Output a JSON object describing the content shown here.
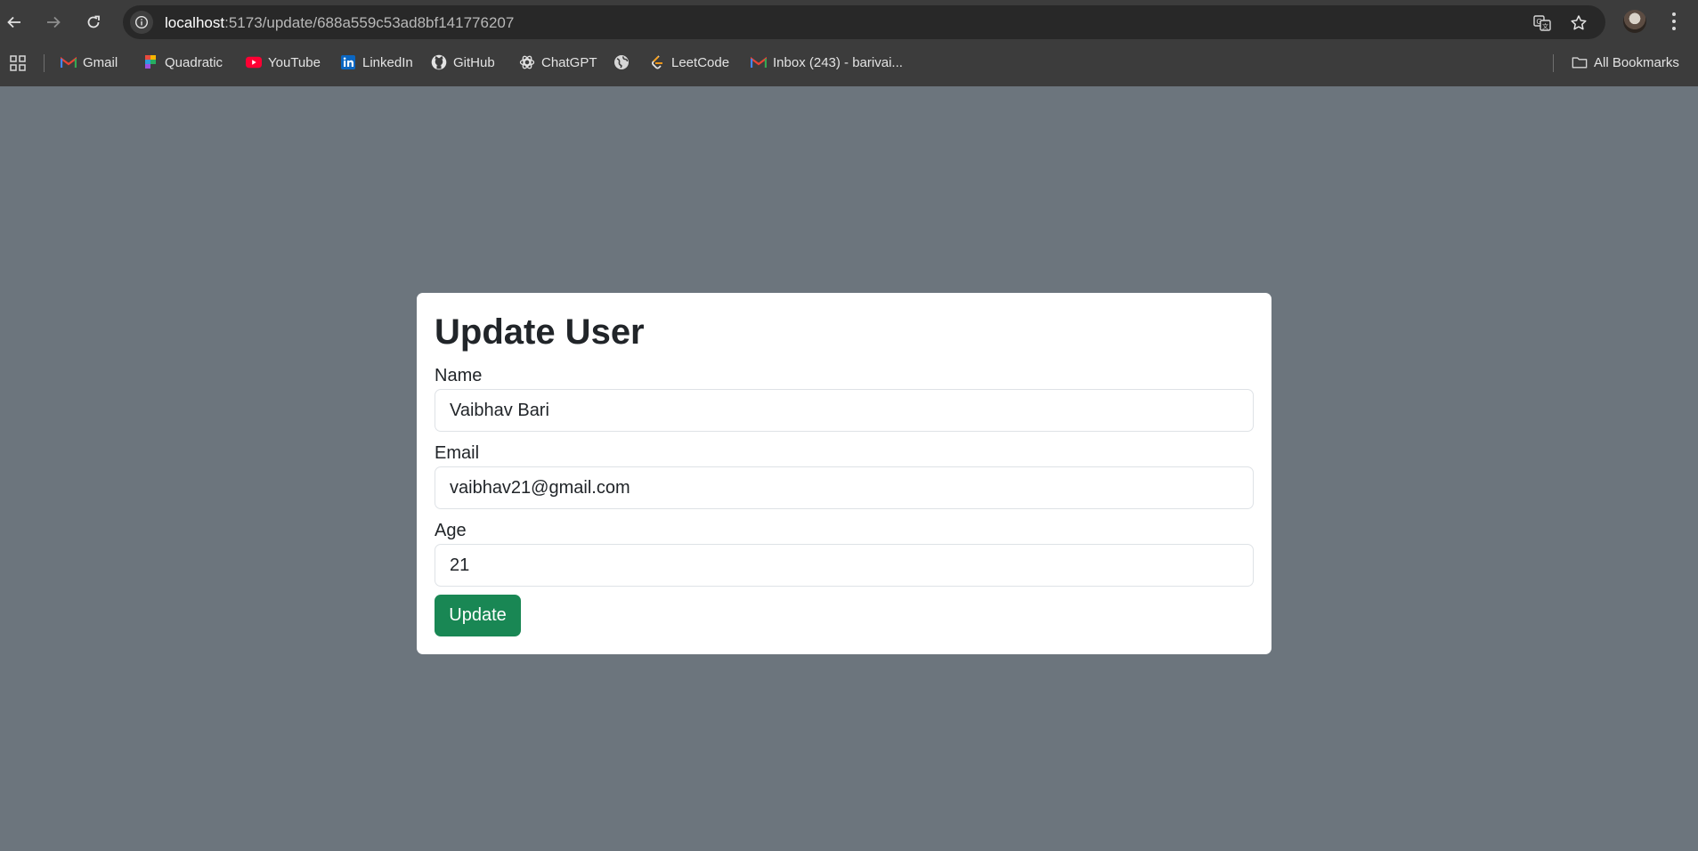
{
  "browser": {
    "url_host": "localhost",
    "url_path": ":5173/update/688a559c53ad8bf141776207",
    "bookmarks": [
      {
        "label": "Gmail",
        "icon": "gmail-icon"
      },
      {
        "label": "Quadratic",
        "icon": "quadratic-icon"
      },
      {
        "label": "YouTube",
        "icon": "youtube-icon"
      },
      {
        "label": "LinkedIn",
        "icon": "linkedin-icon"
      },
      {
        "label": "GitHub",
        "icon": "github-icon"
      },
      {
        "label": "ChatGPT",
        "icon": "chatgpt-icon"
      },
      {
        "label": "",
        "icon": "globe-icon"
      },
      {
        "label": "LeetCode",
        "icon": "leetcode-icon"
      },
      {
        "label": "Inbox (243) - barivai...",
        "icon": "gmail-icon"
      }
    ],
    "all_bookmarks_label": "All Bookmarks"
  },
  "form": {
    "title": "Update User",
    "name_label": "Name",
    "name_value": "Vaibhav Bari",
    "email_label": "Email",
    "email_value": "vaibhav21@gmail.com",
    "age_label": "Age",
    "age_value": "21",
    "submit_label": "Update"
  },
  "colors": {
    "page_background": "#6c757d",
    "browser_chrome": "#3c3c3c",
    "submit_button": "#198754",
    "card_background": "#ffffff"
  }
}
